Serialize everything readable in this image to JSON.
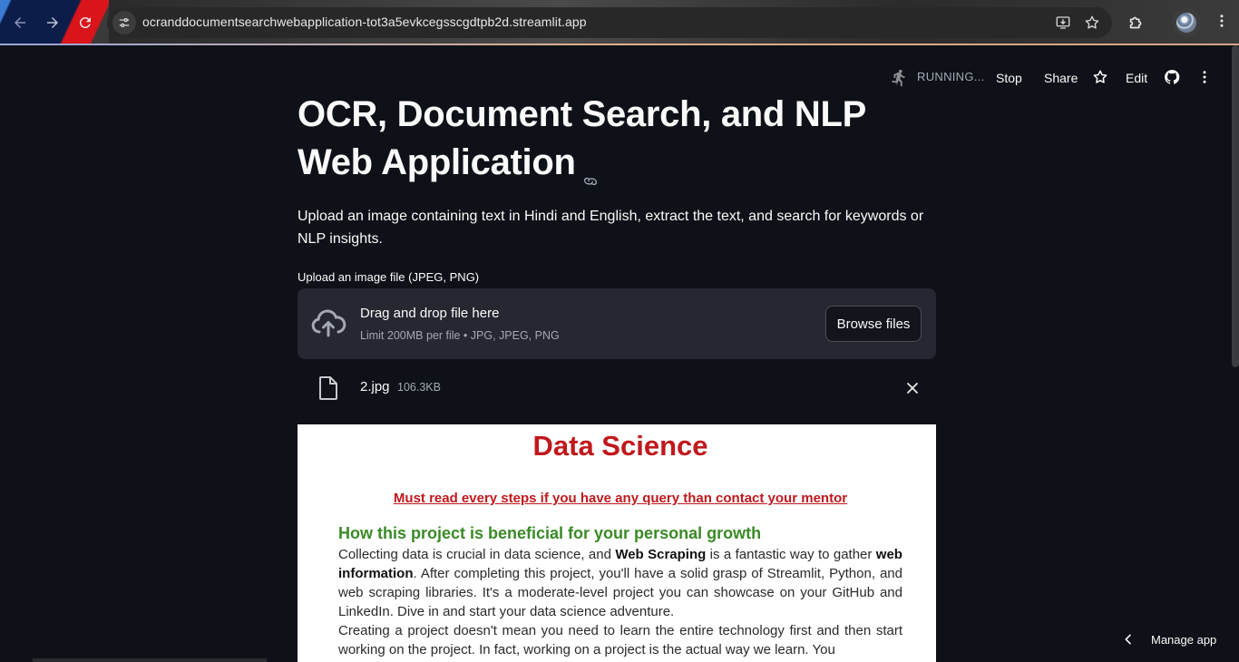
{
  "browser": {
    "url": "ocranddocumentsearchwebapplication-tot3a5evkcegsscgdtpb2d.streamlit.app"
  },
  "toolbar": {
    "status": "RUNNING...",
    "stop": "Stop",
    "share": "Share",
    "edit": "Edit"
  },
  "page": {
    "title_line1": "OCR, Document Search, and NLP",
    "title_line2": "Web Application",
    "description": "Upload an image containing text in Hindi and English, extract the text, and search for keywords or NLP insights."
  },
  "uploader": {
    "label": "Upload an image file (JPEG, PNG)",
    "drop_title": "Drag and drop file here",
    "drop_sub": "Limit 200MB per file • JPG, JPEG, PNG",
    "browse_label": "Browse files",
    "file": {
      "name": "2.jpg",
      "size": "106.3KB"
    }
  },
  "preview": {
    "title": "Data Science",
    "warning": "Must read every steps if you have any query than contact your mentor",
    "heading": "How this project is beneficial for your personal growth",
    "p1_a": "Collecting data is crucial in data science, and ",
    "p1_b": "Web Scraping",
    "p1_c": " is a fantastic way to gather ",
    "p1_d": "web information",
    "p1_e": ". After completing this project, you'll have a solid grasp of Streamlit, Python, and web scraping libraries. It's a moderate-level project you can showcase on your GitHub and LinkedIn. Dive in and start your data science adventure.",
    "p2": "Creating a project doesn't mean you need to learn the entire technology first and then start working on the project. In fact, working on a project is the actual way we learn. You"
  },
  "footer": {
    "manage_app": "Manage app"
  }
}
